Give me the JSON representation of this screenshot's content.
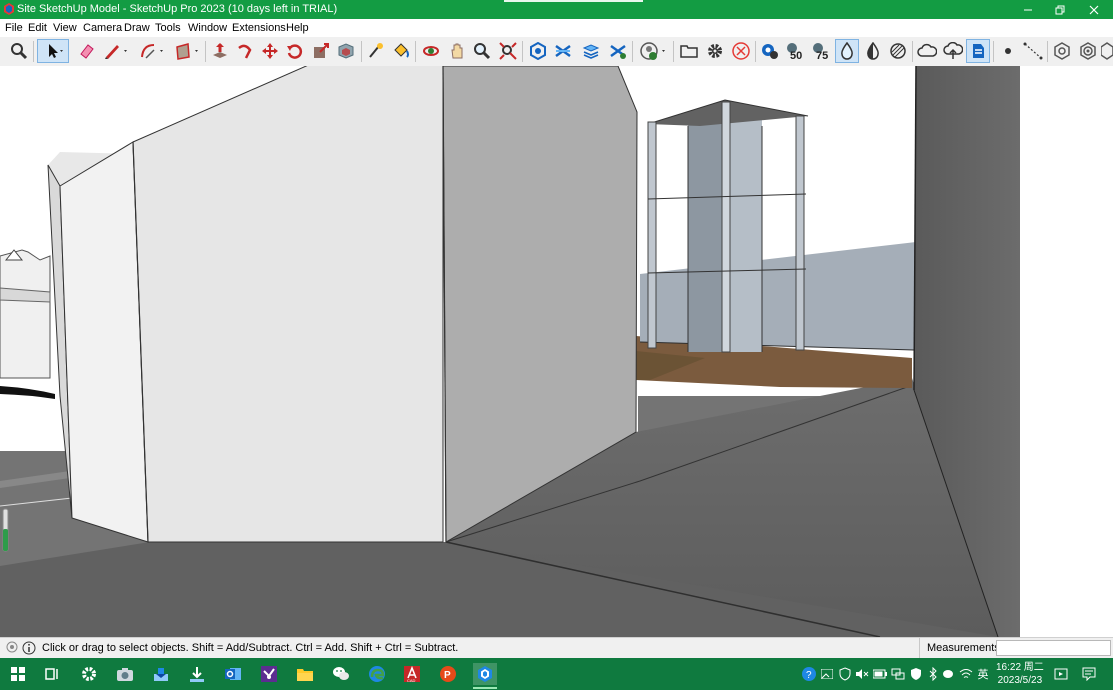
{
  "window": {
    "title": "Site SketchUp Model - SketchUp Pro 2023 (10 days left in TRIAL)",
    "app_icon": "sketchup-logo-icon",
    "controls": [
      "minimize-icon",
      "restore-icon",
      "close-icon"
    ],
    "accent_color": "#139c43"
  },
  "menu": {
    "items": [
      "File",
      "Edit",
      "View",
      "Camera",
      "Draw",
      "Tools",
      "Window",
      "Extensions",
      "Help"
    ]
  },
  "toolbar": {
    "selected_tool": "select",
    "tools": [
      "zoom",
      "select",
      "eraser",
      "line",
      "arc",
      "rectangle",
      "push-pull",
      "follow-me",
      "move",
      "rotate",
      "scale",
      "offset",
      "tape-measure",
      "paint-bucket",
      "orbit",
      "pan",
      "zoom",
      "zoom-extents",
      "section",
      "sandbox-1",
      "sandbox-2",
      "sandbox-3",
      "user-location",
      "open-folder",
      "settings",
      "cancel",
      "view-1",
      "view-50",
      "view-75",
      "shade-1",
      "shade-2",
      "shade-3",
      "cloud-1",
      "cloud-2",
      "cloud-3",
      "point",
      "dimension",
      "gear-1",
      "gear-2"
    ],
    "badges": [
      "50",
      "75"
    ]
  },
  "status": {
    "message": "Click or drag to select objects. Shift = Add/Subtract. Ctrl = Add. Shift + Ctrl = Subtract.",
    "measurements_label": "Measurements",
    "measurements_value": ""
  },
  "taskbar": {
    "apps": [
      "windows-start",
      "task-view",
      "settings",
      "camera",
      "installer",
      "outlook",
      "visual-studio",
      "file-explorer",
      "wechat",
      "edge",
      "autocad",
      "powerpoint",
      "sketchup"
    ],
    "autocad_label": "CAD",
    "ime_label": "英",
    "time": "16:22 周二",
    "date": "2023/5/23"
  }
}
